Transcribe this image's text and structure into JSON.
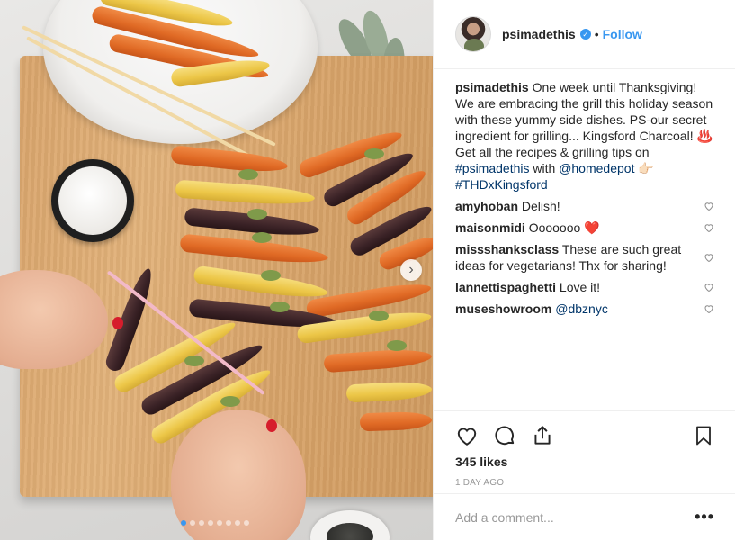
{
  "photo": {
    "alt_icon": "carousel-next-icon",
    "carousel_dot_count": 8,
    "carousel_active_index": 0,
    "next_glyph": "›"
  },
  "post": {
    "username": "psimadethis",
    "verified": true,
    "separator": "•",
    "follow_label": "Follow",
    "caption": {
      "author": "psimadethis",
      "text_1": "One week until Thanksgiving! We are embracing the grill this holiday season with these yummy side dishes. PS-our secret ingredient for grilling... Kingsford Charcoal! ♨️ Get all the recipes & grilling tips on ",
      "hashtag_1": "#psimadethis",
      "text_2": " with ",
      "mention_1": "@homedepot",
      "text_3": " 👉🏻 ",
      "hashtag_2": "#THDxKingsford"
    },
    "comments": [
      {
        "user": "amyhoban",
        "text": "Delish!"
      },
      {
        "user": "maisonmidi",
        "text": "Ooooooo",
        "emoji": "❤️"
      },
      {
        "user": "missshanksclass",
        "text": "These are such great ideas for vegetarians! Thx for sharing!"
      },
      {
        "user": "lannettispaghetti",
        "text": "Love it!"
      },
      {
        "user": "museshowroom",
        "mention": "@dbznyc"
      }
    ],
    "likes_label": "345 likes",
    "time_ago": "1 DAY AGO",
    "add_comment_placeholder": "Add a comment...",
    "more_label": "•••"
  },
  "colors": {
    "accent": "#3897f0",
    "link": "#003569",
    "text": "#262626",
    "muted": "#999999",
    "heart_emoji": "#ea2e3c"
  },
  "icons": [
    "heart-icon",
    "comment-icon",
    "share-icon",
    "bookmark-icon",
    "verified-badge-icon",
    "small-heart-icon",
    "more-options-icon"
  ]
}
